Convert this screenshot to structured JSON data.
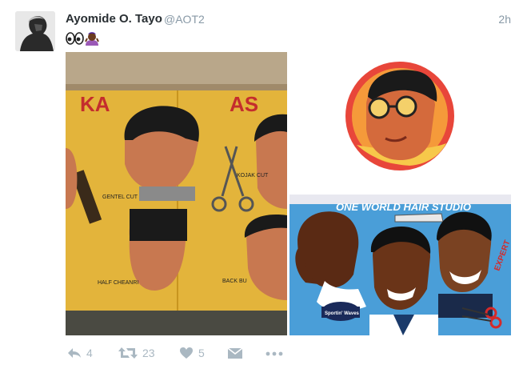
{
  "tweet": {
    "author_name": "Ayomide O. Tayo",
    "handle": "@AOT2",
    "time": "2h",
    "text_emojis": [
      "eyes-emoji",
      "woman-shrugging-emoji"
    ],
    "photos": [
      {
        "name": "barber-sign-painting-1",
        "lettering": [
          "KA",
          "AS"
        ],
        "captions": [
          "GENTEL CUT",
          "KOJAK CUT",
          "HALF CHEANRI",
          "BACK BU"
        ]
      },
      {
        "name": "barber-sign-painting-2",
        "lettering": []
      },
      {
        "name": "barber-sign-painting-3",
        "lettering": [
          "ONE WORLD HAIR STUDIO",
          "Sportin' Waves",
          "EXPERT"
        ]
      }
    ],
    "actions": {
      "reply_count": "4",
      "retweet_count": "23",
      "like_count": "5"
    }
  },
  "colors": {
    "name": "#292f33",
    "meta": "#8899a6",
    "action": "#aab8c2"
  }
}
